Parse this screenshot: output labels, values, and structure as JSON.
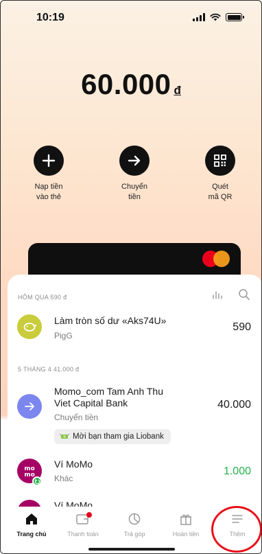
{
  "status_bar": {
    "time": "10:19"
  },
  "balance": {
    "amount": "60.000",
    "currency": "đ"
  },
  "actions": [
    {
      "line1": "Nạp tiền",
      "line2": "vào thẻ",
      "icon": "plus-icon"
    },
    {
      "line1": "Chuyển",
      "line2": "tiền",
      "icon": "arrow-right-icon"
    },
    {
      "line1": "Quét",
      "line2": "mã QR",
      "icon": "qr-code-icon"
    }
  ],
  "card": {
    "brand_icon": "mastercard-logo"
  },
  "transactions": {
    "groups": [
      {
        "header": "HÔM QUA 590 đ",
        "items": [
          {
            "title": "Làm tròn số dư «Aks74U»",
            "subtitle": "PigG",
            "amount": "590",
            "icon": "piggy-bank-icon",
            "icon_color": "#c9cc3b"
          }
        ]
      },
      {
        "header": "5 THÁNG 4 41.000 đ",
        "items": [
          {
            "title_line1": "Momo_com Tam Anh Thu",
            "title_line2": "Viet Capital Bank",
            "subtitle": "Chuyển tiền",
            "amount": "40.000",
            "icon": "arrow-right-icon",
            "icon_color": "#7b86ee",
            "promo": "Mời bạn tham gia Liobank",
            "promo_icon": "money-wings-icon"
          },
          {
            "title": "Ví MoMo",
            "subtitle": "Khác",
            "amount": "1.000",
            "amount_color": "#24b24a",
            "icon": "momo-logo",
            "icon_color": "#a50064"
          },
          {
            "title": "Ví MoMo",
            "icon": "momo-logo",
            "icon_color": "#a50064"
          }
        ]
      }
    ]
  },
  "bottom_nav": [
    {
      "label": "Trang chủ",
      "icon": "home-icon",
      "active": true
    },
    {
      "label": "Thanh toán",
      "icon": "wallet-icon",
      "badge": true
    },
    {
      "label": "Trả góp",
      "icon": "pie-chart-icon"
    },
    {
      "label": "Hoàn tiền",
      "icon": "gift-icon"
    },
    {
      "label": "Thêm",
      "icon": "menu-icon"
    }
  ],
  "colors": {
    "accent_red": "#e8101a",
    "positive_green": "#24b24a",
    "mastercard_red": "#eb001b",
    "mastercard_orange": "#f79e1b"
  }
}
